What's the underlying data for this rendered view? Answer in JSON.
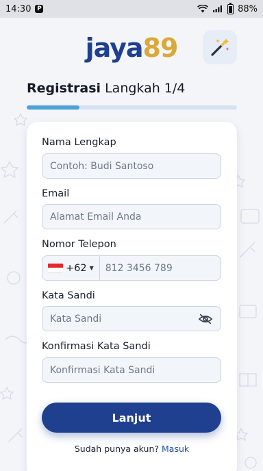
{
  "status_bar": {
    "time": "14:30",
    "badge": "P",
    "battery": "88%"
  },
  "header": {
    "logo_part1": "jaya",
    "logo_part2": "89",
    "wand_icon": "magic-wand-icon"
  },
  "page": {
    "title_bold": "Registrasi",
    "title_rest": " Langkah 1/4",
    "progress": 0.25
  },
  "form": {
    "full_name": {
      "label": "Nama Lengkap",
      "placeholder": "Contoh: Budi Santoso",
      "value": ""
    },
    "email": {
      "label": "Email",
      "placeholder": "Alamat Email Anda",
      "value": ""
    },
    "phone": {
      "label": "Nomor Telepon",
      "country_code": "+62",
      "country_flag": "indonesia-flag",
      "placeholder": "812 3456 789",
      "value": ""
    },
    "password": {
      "label": "Kata Sandi",
      "placeholder": "Kata Sandi",
      "value": "",
      "toggle_icon": "eye-off-icon"
    },
    "confirm_password": {
      "label": "Konfirmasi Kata Sandi",
      "placeholder": "Konfirmasi Kata Sandi",
      "value": ""
    }
  },
  "actions": {
    "next_label": "Lanjut",
    "have_account_text": "Sudah punya akun?",
    "login_link": "Masuk"
  },
  "colors": {
    "primary": "#1f3f8f",
    "accent_gold": "#d9a93a",
    "progress": "#4ea0d8",
    "background": "#f3f5f9"
  }
}
